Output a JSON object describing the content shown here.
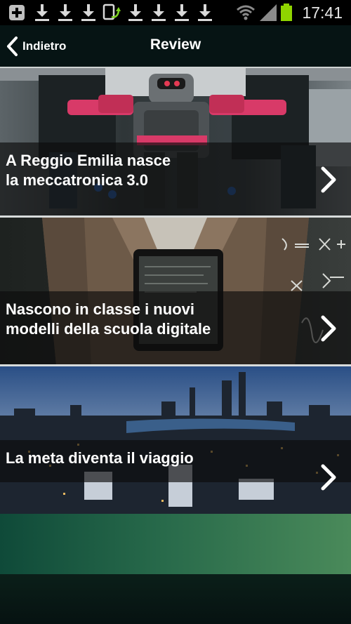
{
  "status_bar": {
    "time": "17:41",
    "icons": [
      "add-box-icon",
      "download-icon",
      "download-icon",
      "download-icon",
      "screen-rotate-icon",
      "download-icon",
      "download-icon",
      "download-icon",
      "download-icon",
      "wifi-icon",
      "signal-icon",
      "battery-icon"
    ]
  },
  "header": {
    "back_label": "Indietro",
    "title": "Review"
  },
  "cards": [
    {
      "title": "A Reggio Emilia nasce\nla meccatronica 3.0"
    },
    {
      "title": "Nascono in classe i nuovi\nmodelli della scuola digitale"
    },
    {
      "title": "La meta diventa il viaggio"
    }
  ],
  "colors": {
    "header_bg": "#061414",
    "bottom_gradient_start": "#0f4a39",
    "bottom_gradient_end": "#4a8a5a",
    "battery": "#8fd400"
  }
}
